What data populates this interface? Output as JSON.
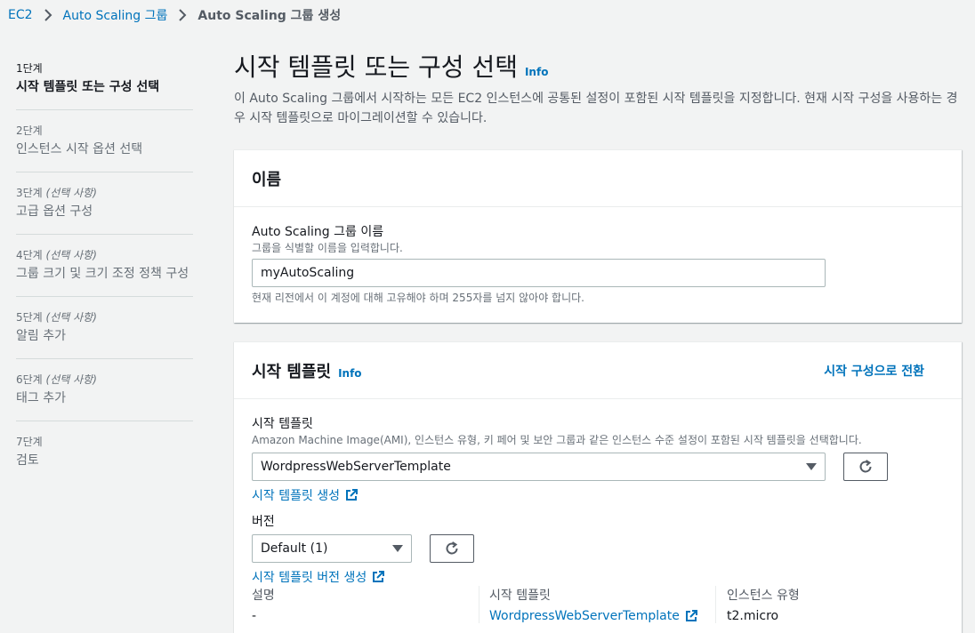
{
  "breadcrumb": {
    "items": [
      "EC2",
      "Auto Scaling 그룹"
    ],
    "current": "Auto Scaling 그룹 생성"
  },
  "steps": [
    {
      "num": "1단계",
      "optional": "",
      "title": "시작 템플릿 또는 구성 선택",
      "active": true
    },
    {
      "num": "2단계",
      "optional": "",
      "title": "인스턴스 시작 옵션 선택",
      "active": false
    },
    {
      "num": "3단계",
      "optional": "(선택 사항)",
      "title": "고급 옵션 구성",
      "active": false
    },
    {
      "num": "4단계",
      "optional": "(선택 사항)",
      "title": "그룹 크기 및 크기 조정 정책 구성",
      "active": false
    },
    {
      "num": "5단계",
      "optional": "(선택 사항)",
      "title": "알림 추가",
      "active": false
    },
    {
      "num": "6단계",
      "optional": "(선택 사항)",
      "title": "태그 추가",
      "active": false
    },
    {
      "num": "7단계",
      "optional": "",
      "title": "검토",
      "active": false
    }
  ],
  "page": {
    "title": "시작 템플릿 또는 구성 선택",
    "info": "Info",
    "description": "이 Auto Scaling 그룹에서 시작하는 모든 EC2 인스턴스에 공통된 설정이 포함된 시작 템플릿을 지정합니다. 현재 시작 구성을 사용하는 경우 시작 템플릿으로 마이그레이션할 수 있습니다."
  },
  "name_panel": {
    "heading": "이름",
    "label": "Auto Scaling 그룹 이름",
    "desc": "그룹을 식별할 이름을 입력합니다.",
    "value": "myAutoScaling",
    "hint": "현재 리전에서 이 계정에 대해 고유해야 하며 255자를 넘지 않아야 합니다."
  },
  "template_panel": {
    "heading": "시작 템플릿",
    "info": "Info",
    "switch_link": "시작 구성으로 전환",
    "template_label": "시작 템플릿",
    "template_desc": "Amazon Machine Image(AMI), 인스턴스 유형, 키 페어 및 보안 그룹과 같은 인스턴스 수준 설정이 포함된 시작 템플릿을 선택합니다.",
    "template_value": "WordpressWebServerTemplate",
    "create_template_link": "시작 템플릿 생성",
    "version_label": "버전",
    "version_value": "Default (1)",
    "create_version_link": "시작 템플릿 버전 생성",
    "details": {
      "desc_label": "설명",
      "desc_value": "-",
      "template_label": "시작 템플릿",
      "template_value": "WordpressWebServerTemplate",
      "type_label": "인스턴스 유형",
      "type_value": "t2.micro"
    }
  }
}
